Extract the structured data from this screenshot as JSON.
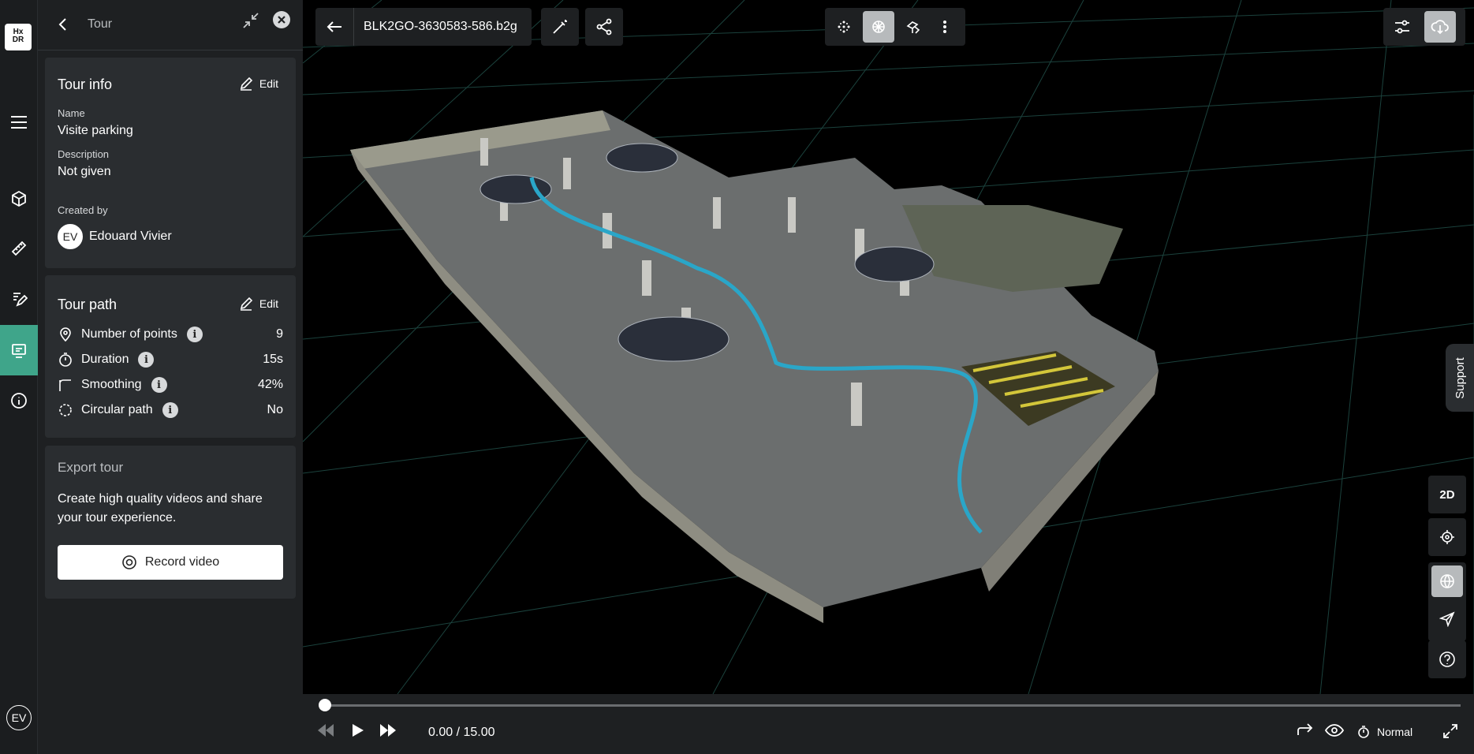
{
  "rail": {
    "logo_top": "Hx",
    "logo_bottom": "DR",
    "user_initials": "EV"
  },
  "panel": {
    "title": "Tour",
    "tour_info": {
      "heading": "Tour info",
      "edit_label": "Edit",
      "name_label": "Name",
      "name_value": "Visite parking",
      "description_label": "Description",
      "description_value": "Not given",
      "created_by_label": "Created by",
      "creator_initials": "EV",
      "creator_name": "Edouard Vivier"
    },
    "tour_path": {
      "heading": "Tour path",
      "edit_label": "Edit",
      "rows": [
        {
          "label": "Number of points",
          "value": "9",
          "icon": "location-pin-icon"
        },
        {
          "label": "Duration",
          "value": "15s",
          "icon": "stopwatch-icon"
        },
        {
          "label": "Smoothing",
          "value": "42%",
          "icon": "smoothing-icon"
        },
        {
          "label": "Circular path",
          "value": "No",
          "icon": "circular-path-icon"
        }
      ]
    },
    "export": {
      "heading": "Export tour",
      "description": "Create high quality videos and share your tour experience.",
      "button_label": "Record video"
    }
  },
  "toolbar": {
    "file_name": "BLK2GO-3630583-586.b2g"
  },
  "right_tools": {
    "mode_2d": "2D",
    "support_label": "Support"
  },
  "playback": {
    "progress": 0,
    "time": "0.00 / 15.00",
    "speed": "Normal"
  },
  "colors": {
    "accent": "#3fa58a",
    "path": "#2aa6c8",
    "panel_bg": "#1e2022",
    "card_bg": "#2a2d30"
  }
}
